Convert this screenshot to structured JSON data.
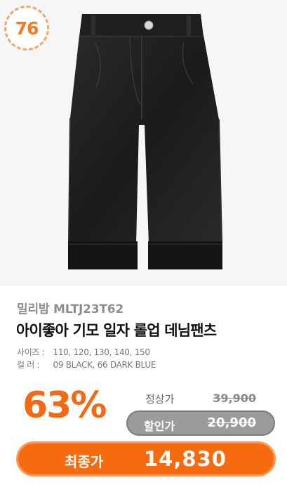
{
  "badge": {
    "rank": "76"
  },
  "product": {
    "brand": "밀리밤 MLTJ23T62",
    "name": "아이좋아 기모 일자 롤업 데님팬츠",
    "specs": [
      {
        "key": "사이즈 :",
        "value": "110, 120, 130, 140, 150"
      },
      {
        "key": "컬   러 :",
        "value": "09 BLACK, 66 DARK BLUE"
      }
    ]
  },
  "pricing": {
    "discount": "63%",
    "regular_label": "정상가",
    "regular_price": "39,900",
    "sale_label": "할인가",
    "sale_price": "20,900",
    "final_label": "최종가",
    "final_price": "14,830"
  },
  "colors": {
    "accent": "#f76b10",
    "badge_text": "#f47a1f",
    "sale_pill": "#9b9b9b"
  }
}
